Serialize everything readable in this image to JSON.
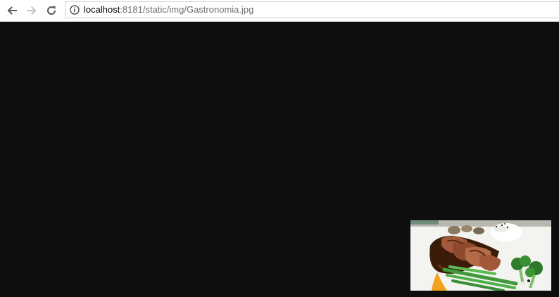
{
  "browser": {
    "back_icon": "arrow-left-icon",
    "forward_icon": "arrow-right-icon",
    "reload_icon": "reload-icon",
    "info_icon": "info-circle-icon",
    "url_host": "localhost",
    "url_rest": ":8181/static/img/Gastronomia.jpg"
  },
  "page": {
    "background_color": "#0e0e0e",
    "image_subject": "plated meal with sliced meat, brown sauce, rice, green beans and broccoli"
  }
}
